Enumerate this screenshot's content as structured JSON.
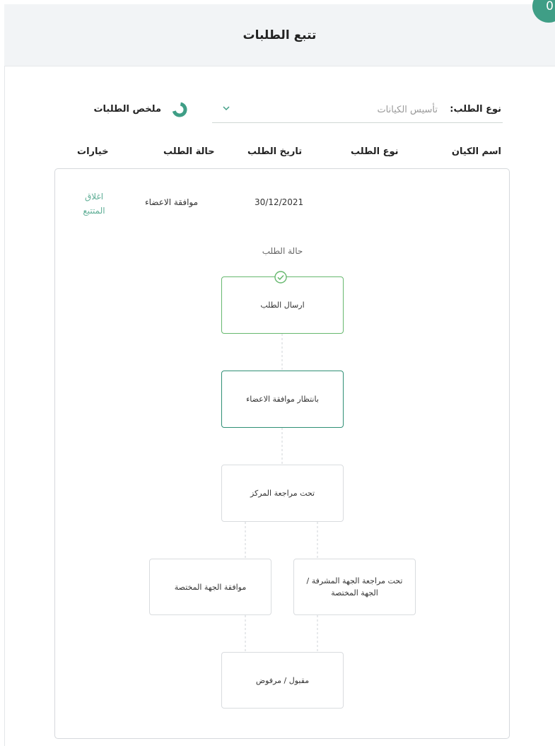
{
  "header": {
    "title": "تتبع الطلبات"
  },
  "badge": {
    "count": "0"
  },
  "filter": {
    "label": "نوع الطلب:",
    "selected": "تأسيس الكيانات"
  },
  "summary": {
    "label": "ملخص الطلبات"
  },
  "columns": {
    "entity_name": "اسم الكيان",
    "request_type": "نوع الطلب",
    "request_date": "تاريخ الطلب",
    "request_status": "حالة الطلب",
    "options": "خيارات"
  },
  "row": {
    "date": "30/12/2021",
    "status": "موافقة الاعضاء",
    "action": "اغلاق المتتبع"
  },
  "flow": {
    "title": "حالة الطلب",
    "steps": {
      "submitted": "ارسال الطلب",
      "awaiting_members": "بانتظار موافقة الاعضاء",
      "center_review": "تحت مراجعة المركز",
      "supervisor_review": "تحت مراجعة الجهة المشرفة / الجهة المختصة",
      "authority_approval": "موافقة الجهة المختصة",
      "final": "مقبول / مرفوض"
    }
  },
  "colors": {
    "accent": "#3f9e86",
    "done": "#66b86e",
    "current": "#2f8f75"
  },
  "icons": {
    "summary": "donut-chart-icon",
    "chevron": "chevron-down-icon",
    "check": "check-circle-icon"
  }
}
